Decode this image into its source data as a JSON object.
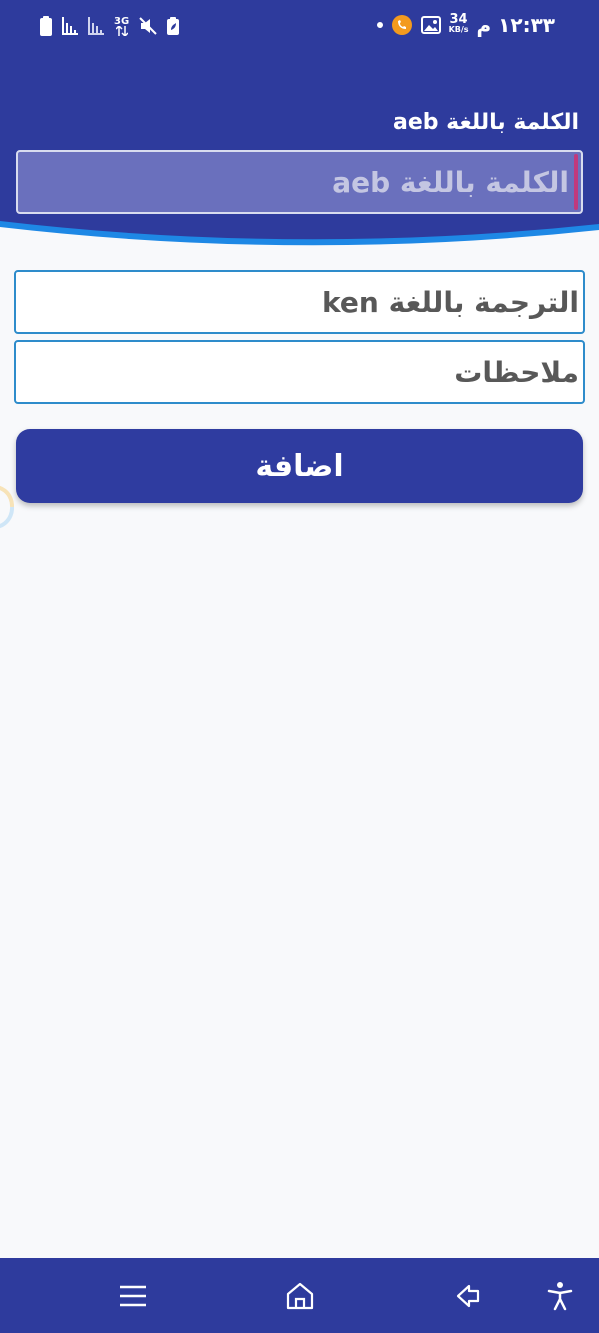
{
  "status_bar": {
    "time": "١٢:٣٣ م",
    "network_type": "3G",
    "speed_value": "34",
    "speed_unit": "KB/s"
  },
  "form": {
    "word_label": "الكلمة باللغة aeb",
    "word_placeholder": "الكلمة باللغة aeb",
    "translation_placeholder": "الترجمة باللغة ken",
    "notes_placeholder": "ملاحظات",
    "add_button_label": "اضافة"
  },
  "nav_bar": {
    "buttons": [
      "menu",
      "home",
      "back",
      "accessibility"
    ]
  },
  "colors": {
    "primary": "#2e3b9d",
    "accent_curve": "#1e88e5",
    "field_border": "#2e8ccb",
    "background": "#f8f9fb"
  }
}
